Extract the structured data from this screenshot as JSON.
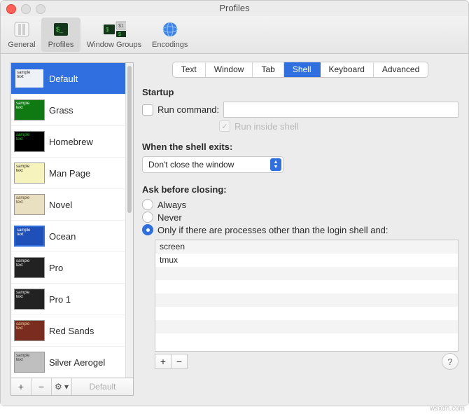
{
  "window": {
    "title": "Profiles"
  },
  "toolbar": {
    "items": [
      {
        "label": "General"
      },
      {
        "label": "Profiles"
      },
      {
        "label": "Window Groups"
      },
      {
        "label": "Encodings"
      }
    ],
    "active_index": 1
  },
  "sidebar": {
    "profiles": [
      {
        "name": "Default",
        "bg": "#eef1f6",
        "fg": "#2a2a2a",
        "border": "#2f6fe0",
        "selected": true
      },
      {
        "name": "Grass",
        "bg": "#0f7a12",
        "fg": "#ffffff"
      },
      {
        "name": "Homebrew",
        "bg": "#000000",
        "fg": "#1bd11b"
      },
      {
        "name": "Man Page",
        "bg": "#f7f3bd",
        "fg": "#2a2a2a"
      },
      {
        "name": "Novel",
        "bg": "#e9dfc1",
        "fg": "#5a4a2a"
      },
      {
        "name": "Ocean",
        "bg": "#1f4fb8",
        "fg": "#ffffff",
        "border": "#2f6fe0"
      },
      {
        "name": "Pro",
        "bg": "#222222",
        "fg": "#eeeeee"
      },
      {
        "name": "Pro 1",
        "bg": "#222222",
        "fg": "#eeeeee"
      },
      {
        "name": "Red Sands",
        "bg": "#7a2d1e",
        "fg": "#e7d6a0"
      },
      {
        "name": "Silver Aerogel",
        "bg": "#bfbfbf",
        "fg": "#3a3a3a"
      }
    ],
    "buttons": {
      "add": "+",
      "remove": "−",
      "menu": "⚙︎ ▾",
      "default": "Default"
    }
  },
  "tabs": {
    "items": [
      "Text",
      "Window",
      "Tab",
      "Shell",
      "Keyboard",
      "Advanced"
    ],
    "active_index": 3
  },
  "startup": {
    "heading": "Startup",
    "run_command_label": "Run command:",
    "run_command_checked": false,
    "run_command_value": "",
    "run_inside_shell_label": "Run inside shell",
    "run_inside_shell_checked": true,
    "run_inside_shell_disabled": true
  },
  "exit": {
    "heading": "When the shell exits:",
    "select_value": "Don't close the window"
  },
  "ask": {
    "heading": "Ask before closing:",
    "options": [
      "Always",
      "Never",
      "Only if there are processes other than the login shell and:"
    ],
    "selected_index": 2
  },
  "process_list": [
    "screen",
    "tmux"
  ],
  "list_buttons": {
    "add": "+",
    "remove": "−"
  },
  "help": "?",
  "watermark": "wsxdn.com"
}
